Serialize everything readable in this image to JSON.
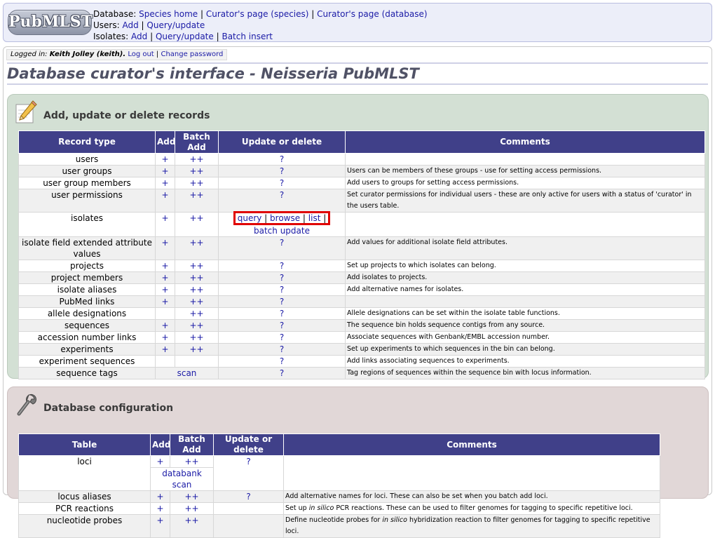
{
  "header": {
    "logo_text": "PubMLST",
    "database_label": "Database:",
    "database_links": [
      "Species home",
      "Curator's page (species)",
      "Curator's page (database)"
    ],
    "users_label": "Users:",
    "users_links": [
      "Add",
      "Query/update"
    ],
    "isolates_label": "Isolates:",
    "isolates_links": [
      "Add",
      "Query/update",
      "Batch insert"
    ]
  },
  "login": {
    "prefix": "Logged in:",
    "user": "Keith Jolley (keith).",
    "logout": "Log out",
    "change_password": "Change password"
  },
  "page_title": "Database curator's interface - Neisseria PubMLST",
  "records_panel": {
    "title": "Add, update or delete records",
    "headers": [
      "Record type",
      "Add",
      "Batch Add",
      "Update or delete",
      "Comments"
    ],
    "rows": [
      {
        "type": "users",
        "add": "+",
        "batch": "++",
        "update": "?",
        "comment": ""
      },
      {
        "type": "user groups",
        "add": "+",
        "batch": "++",
        "update": "?",
        "comment": "Users can be members of these groups - use for setting access permissions."
      },
      {
        "type": "user group members",
        "add": "+",
        "batch": "++",
        "update": "?",
        "comment": "Add users to groups for setting access permissions."
      },
      {
        "type": "user permissions",
        "add": "+",
        "batch": "++",
        "update": "?",
        "comment": "Set curator permissions for individual users - these are only active for users with a status of 'curator' in the users table."
      },
      {
        "type": "isolates",
        "add": "+",
        "batch": "++",
        "update_links": [
          "query",
          "browse",
          "list"
        ],
        "update_extra": "batch update",
        "comment": ""
      },
      {
        "type": "isolate field extended attribute values",
        "add": "+",
        "batch": "++",
        "update": "?",
        "comment": "Add values for additional isolate field attributes."
      },
      {
        "type": "projects",
        "add": "+",
        "batch": "++",
        "update": "?",
        "comment": "Set up projects to which isolates can belong."
      },
      {
        "type": "project members",
        "add": "+",
        "batch": "++",
        "update": "?",
        "comment": "Add isolates to projects."
      },
      {
        "type": "isolate aliases",
        "add": "+",
        "batch": "++",
        "update": "?",
        "comment": "Add alternative names for isolates."
      },
      {
        "type": "PubMed links",
        "add": "+",
        "batch": "++",
        "update": "?",
        "comment": ""
      },
      {
        "type": "allele designations",
        "add": "",
        "batch": "++",
        "update": "?",
        "comment": "Allele designations can be set within the isolate table functions."
      },
      {
        "type": "sequences",
        "add": "+",
        "batch": "++",
        "update": "?",
        "comment": "The sequence bin holds sequence contigs from any source."
      },
      {
        "type": "accession number links",
        "add": "+",
        "batch": "++",
        "update": "?",
        "comment": "Associate sequences with Genbank/EMBL accession number."
      },
      {
        "type": "experiments",
        "add": "+",
        "batch": "++",
        "update": "?",
        "comment": "Set up experiments to which sequences in the bin can belong."
      },
      {
        "type": "experiment sequences",
        "add": "",
        "batch": "",
        "update": "?",
        "comment": "Add links associating sequences to experiments."
      },
      {
        "type": "sequence tags",
        "add_batch_merged": "scan",
        "update": "?",
        "comment": "Tag regions of sequences within the sequence bin with locus information."
      }
    ]
  },
  "config_panel": {
    "title": "Database configuration",
    "headers": [
      "Table",
      "Add",
      "Batch Add",
      "Update or delete",
      "Comments"
    ],
    "rows": [
      {
        "type": "loci",
        "add": "+",
        "batch": "++",
        "update": "?",
        "extra": "databank scan",
        "comment": ""
      },
      {
        "type": "locus aliases",
        "add": "+",
        "batch": "++",
        "update": "?",
        "comment": "Add alternative names for loci. These can also be set when you batch add loci."
      },
      {
        "type": "PCR reactions",
        "add": "+",
        "batch": "++",
        "update": "",
        "comment_pre": "Set up ",
        "comment_em": "in silico",
        "comment_post": " PCR reactions. These can be used to filter genomes for tagging to specific repetitive loci."
      },
      {
        "type": "nucleotide probes",
        "add": "+",
        "batch": "++",
        "update": "",
        "comment_pre": "Define nucleotide probes for ",
        "comment_em": "in silico",
        "comment_post": " hybridization reaction to filter genomes for tagging to specific repetitive loci."
      }
    ]
  }
}
